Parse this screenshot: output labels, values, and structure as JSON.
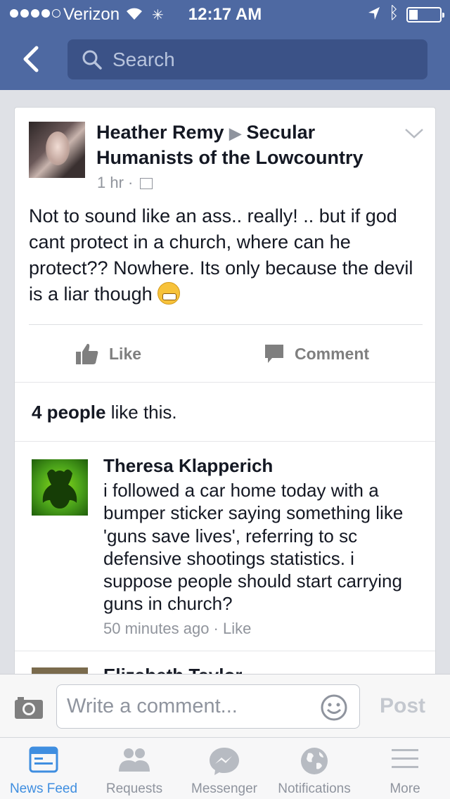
{
  "status_bar": {
    "carrier": "Verizon",
    "time": "12:17 AM"
  },
  "nav": {
    "search_placeholder": "Search"
  },
  "post": {
    "author": "Heather Remy",
    "group": "Secular Humanists of the Lowcountry",
    "time": "1 hr",
    "text": "Not to sound like an ass.. really! .. but if god cant protect in a church, where can he protect?? Nowhere. Its only because the devil is a liar though",
    "like_label": "Like",
    "comment_label": "Comment",
    "likes_count": "4 people",
    "likes_suffix": " like this."
  },
  "comments": [
    {
      "author": "Theresa Klapperich",
      "text": "i followed a car home today with a bumper sticker saying something like 'guns save lives', referring to sc defensive shootings statistics.  i suppose people should start carrying guns in church?",
      "time": "50 minutes ago",
      "like_label": "Like"
    },
    {
      "author": "Elizabeth Taylor"
    }
  ],
  "composer": {
    "placeholder": "Write a comment...",
    "post_label": "Post"
  },
  "tabs": [
    {
      "label": "News Feed",
      "icon": "news-feed-icon",
      "active": true
    },
    {
      "label": "Requests",
      "icon": "friend-requests-icon",
      "active": false
    },
    {
      "label": "Messenger",
      "icon": "messenger-icon",
      "active": false
    },
    {
      "label": "Notifications",
      "icon": "globe-icon",
      "active": false
    },
    {
      "label": "More",
      "icon": "hamburger-icon",
      "active": false
    }
  ],
  "colors": {
    "nav_blue": "#4e69a2",
    "active_tab": "#3f8ee0"
  }
}
